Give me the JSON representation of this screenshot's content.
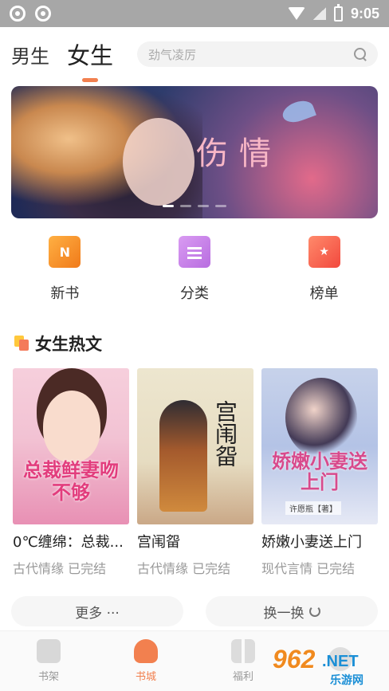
{
  "status_bar": {
    "time": "9:05"
  },
  "header": {
    "tabs": [
      {
        "label": "男生",
        "active": false
      },
      {
        "label": "女生",
        "active": true
      }
    ],
    "search_placeholder": "劲气凌厉"
  },
  "banner": {
    "title": "伤情",
    "slide_count": 4,
    "active_slide": 1
  },
  "entries": [
    {
      "label": "新书",
      "icon": "new-book-icon",
      "icon_text": "N"
    },
    {
      "label": "分类",
      "icon": "category-icon"
    },
    {
      "label": "榜单",
      "icon": "rank-icon"
    }
  ],
  "section": {
    "title": "女生热文",
    "books": [
      {
        "name": "0℃缠绵：总裁...",
        "meta": "古代情缘 已完结",
        "cover_title": "总裁鲜妻吻不够"
      },
      {
        "name": "宫闱㽜",
        "meta": "古代情缘 已完结",
        "cover_title": "宫闱㽜"
      },
      {
        "name": "娇嫩小妻送上门",
        "meta": "现代言情 已完结",
        "cover_title": "娇嫩小妻送上门",
        "cover_author": "许愿瓶【著】"
      }
    ],
    "more_label": "更多 ···",
    "refresh_label": "换一换"
  },
  "tab_bar": {
    "items": [
      {
        "label": "书架",
        "icon": "bookshelf-icon",
        "active": false
      },
      {
        "label": "书城",
        "icon": "bookstore-icon",
        "active": true
      },
      {
        "label": "福利",
        "icon": "gift-icon",
        "active": false
      },
      {
        "label": "",
        "icon": "profile-icon",
        "active": false
      }
    ]
  },
  "watermark": {
    "number": "962",
    "domain": ".NET",
    "text": "乐游网"
  },
  "colors": {
    "accent": "#f2804f",
    "status_bar": "#a7a7a7"
  }
}
